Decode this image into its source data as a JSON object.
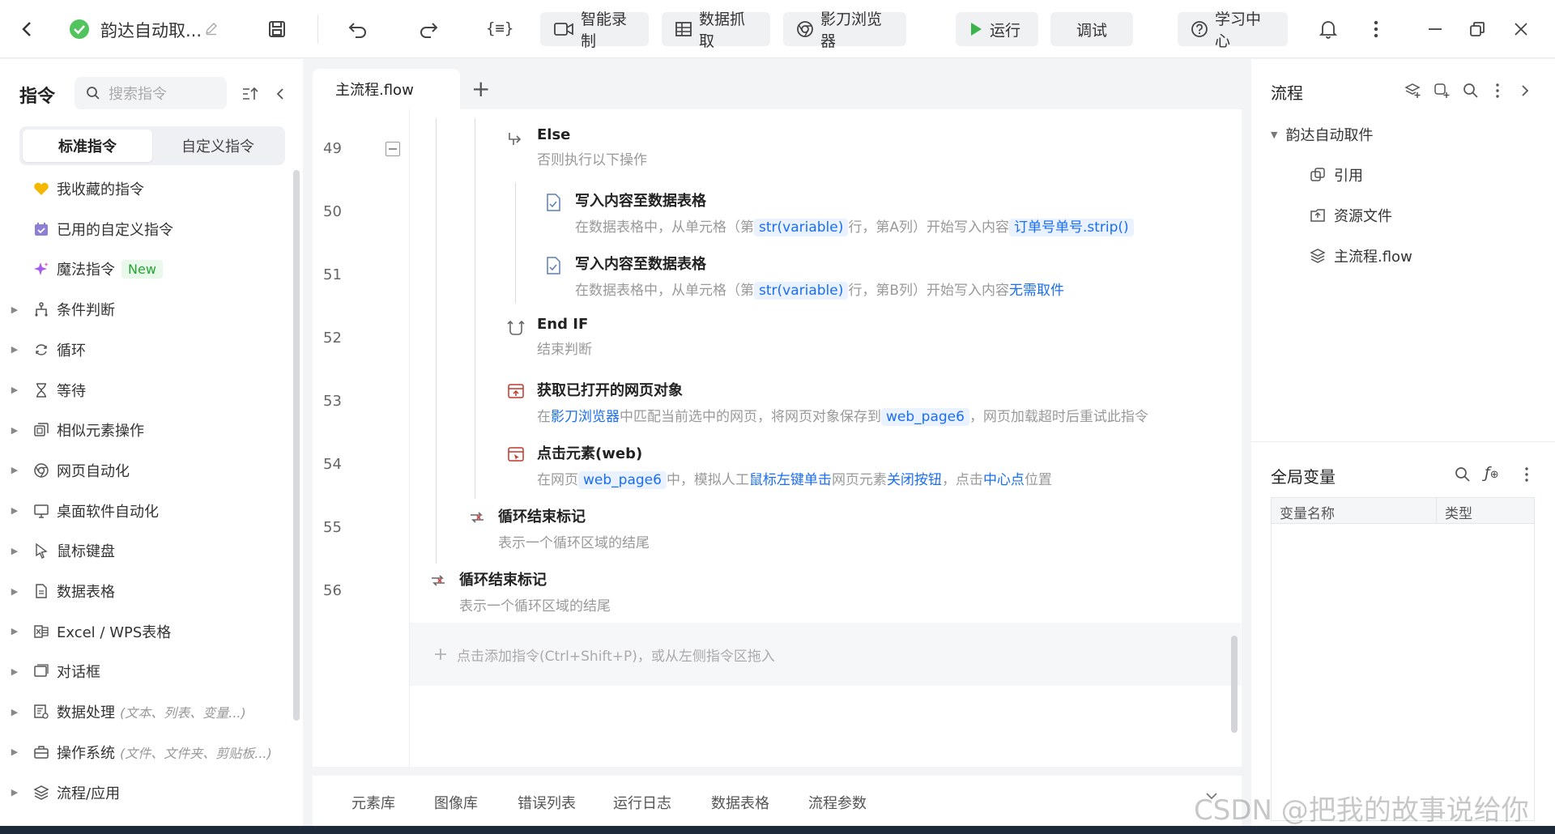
{
  "topbar": {
    "title": "韵达自动取...",
    "smart_record": "智能录制",
    "data_capture": "数据抓取",
    "browser": "影刀浏览器",
    "run": "运行",
    "debug": "调试",
    "learn": "学习中心",
    "vars_icon_text": "{≡}"
  },
  "left": {
    "header": "指令",
    "search_placeholder": "搜索指令",
    "tab_standard": "标准指令",
    "tab_custom": "自定义指令",
    "items": [
      {
        "label": "我收藏的指令",
        "icon": "heart-icon",
        "expandable": false
      },
      {
        "label": "已用的自定义指令",
        "icon": "calendar-check-icon",
        "expandable": false
      },
      {
        "label": "魔法指令",
        "icon": "sparkle-icon",
        "expandable": false,
        "badge": "New"
      },
      {
        "label": "条件判断",
        "icon": "branch-icon",
        "expandable": true
      },
      {
        "label": "循环",
        "icon": "loop-icon",
        "expandable": true
      },
      {
        "label": "等待",
        "icon": "hourglass-icon",
        "expandable": true
      },
      {
        "label": "相似元素操作",
        "icon": "copy-icon",
        "expandable": true
      },
      {
        "label": "网页自动化",
        "icon": "browser-icon",
        "expandable": true
      },
      {
        "label": "桌面软件自动化",
        "icon": "monitor-icon",
        "expandable": true
      },
      {
        "label": "鼠标键盘",
        "icon": "cursor-icon",
        "expandable": true
      },
      {
        "label": "数据表格",
        "icon": "doc-icon",
        "expandable": true
      },
      {
        "label": "Excel / WPS表格",
        "icon": "excel-icon",
        "expandable": true
      },
      {
        "label": "对话框",
        "icon": "dialog-icon",
        "expandable": true
      },
      {
        "label": "数据处理",
        "icon": "data-icon",
        "expandable": true,
        "hint": "(文本、列表、变量...)"
      },
      {
        "label": "操作系统",
        "icon": "os-icon",
        "expandable": true,
        "hint": "(文件、文件夹、剪贴板...)"
      },
      {
        "label": "流程/应用",
        "icon": "layers-icon",
        "expandable": true
      }
    ]
  },
  "editor": {
    "tab_label": "主流程.flow",
    "add_tab": "+",
    "line_numbers": [
      "49",
      "50",
      "51",
      "52",
      "53",
      "54",
      "55",
      "56"
    ],
    "steps": {
      "else_title": "Else",
      "else_desc": "否则执行以下操作",
      "write1_title": "写入内容至数据表格",
      "write1_pre": "在数据表格中，从单元格（第",
      "write1_var": "str(variable)",
      "write1_mid": "行，第A列）开始写入内容",
      "write1_val": "订单号单号.strip()",
      "write2_title": "写入内容至数据表格",
      "write2_pre": "在数据表格中，从单元格（第",
      "write2_var": "str(variable)",
      "write2_mid": "行，第B列）开始写入内容",
      "write2_val": "无需取件",
      "endif_title": "End IF",
      "endif_desc": "结束判断",
      "getpage_title": "获取已打开的网页对象",
      "getpage_d1": "在",
      "getpage_browser": "影刀浏览器",
      "getpage_d2": "中匹配当前选中的网页，将网页对象保存到",
      "getpage_var": "web_page6",
      "getpage_d3": "，网页加载超时后重试此指令",
      "click_title": "点击元素(web)",
      "click_d1": "在网页",
      "click_var": "web_page6",
      "click_d2": "中，模拟人工",
      "click_action": "鼠标左键单击",
      "click_d3": "网页元素",
      "click_elem": "关闭按钮",
      "click_d4": "，点击",
      "click_pos": "中心点",
      "click_d5": "位置",
      "loopend1_title": "循环结束标记",
      "loopend1_desc": "表示一个循环区域的结尾",
      "loopend2_title": "循环结束标记",
      "loopend2_desc": "表示一个循环区域的结尾"
    },
    "add_hint": "点击添加指令(Ctrl+Shift+P)，或从左侧指令区拖入"
  },
  "bottom_tabs": [
    "元素库",
    "图像库",
    "错误列表",
    "运行日志",
    "数据表格",
    "流程参数"
  ],
  "right": {
    "flow_title": "流程",
    "tree_root": "韵达自动取件",
    "tree_items": [
      "引用",
      "资源文件",
      "主流程.flow"
    ],
    "vars_title": "全局变量",
    "col_name": "变量名称",
    "col_type": "类型"
  },
  "watermark": "CSDN @把我的故事说给你"
}
